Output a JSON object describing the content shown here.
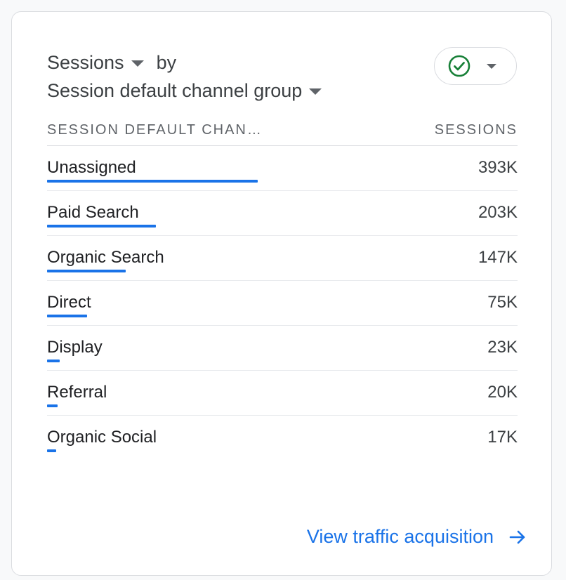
{
  "card": {
    "metric_label": "Sessions",
    "by_label": "by",
    "dimension_label": "Session default channel group",
    "compare_status_icon": "check-circle-icon",
    "accent_color": "#1a73e8",
    "check_color": "#188038"
  },
  "table": {
    "header_dimension": "SESSION DEFAULT CHAN…",
    "header_metric": "SESSIONS",
    "max_value": 393,
    "rows": [
      {
        "label": "Unassigned",
        "value_text": "393K",
        "value": 393
      },
      {
        "label": "Paid Search",
        "value_text": "203K",
        "value": 203
      },
      {
        "label": "Organic Search",
        "value_text": "147K",
        "value": 147
      },
      {
        "label": "Direct",
        "value_text": "75K",
        "value": 75
      },
      {
        "label": "Display",
        "value_text": "23K",
        "value": 23
      },
      {
        "label": "Referral",
        "value_text": "20K",
        "value": 20
      },
      {
        "label": "Organic Social",
        "value_text": "17K",
        "value": 17
      }
    ]
  },
  "footer": {
    "link_label": "View traffic acquisition",
    "link_icon": "arrow-right-icon"
  }
}
